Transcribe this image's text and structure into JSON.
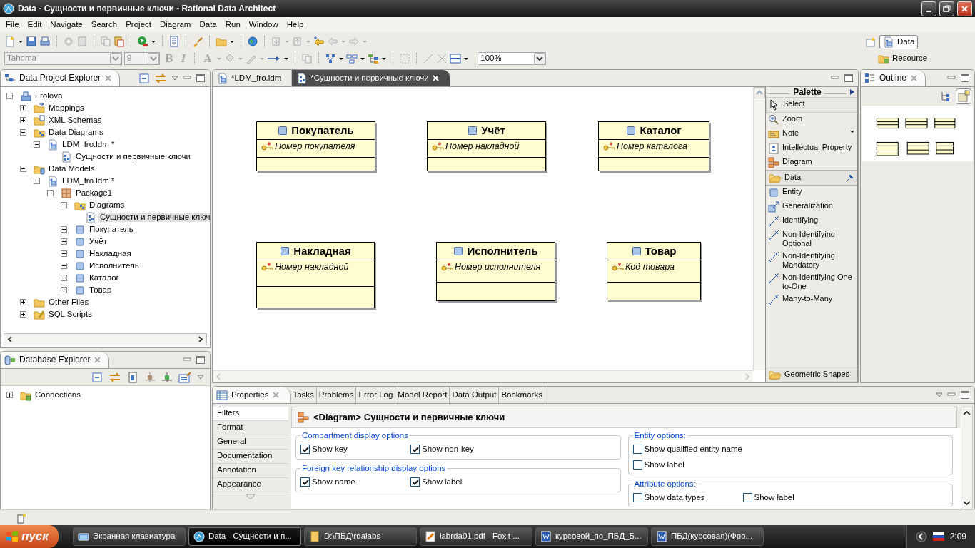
{
  "window": {
    "title": "Data - Сущности и первичные ключи - Rational Data Architect"
  },
  "menu": [
    "File",
    "Edit",
    "Navigate",
    "Search",
    "Project",
    "Diagram",
    "Data",
    "Run",
    "Window",
    "Help"
  ],
  "format_toolbar": {
    "font": "Tahoma",
    "size": "9",
    "bold": "B",
    "italic": "I",
    "font_color": "A",
    "zoom": "100%"
  },
  "perspectives": [
    {
      "label": "Data",
      "kind": "data",
      "selected": true
    },
    {
      "label": "Resource",
      "kind": "resource",
      "selected": false
    }
  ],
  "project_explorer": {
    "title": "Data Project Explorer",
    "tree": [
      {
        "label": "Frolova",
        "kind": "project",
        "expanded": true,
        "selected": false,
        "children": [
          {
            "label": "Mappings",
            "kind": "mappings",
            "expanded": false,
            "selected": false
          },
          {
            "label": "XML Schemas",
            "kind": "xml",
            "expanded": false,
            "selected": false
          },
          {
            "label": "Data Diagrams",
            "kind": "diagrams",
            "expanded": true,
            "selected": false,
            "children": [
              {
                "label": "LDM_fro.ldm *",
                "kind": "ldm",
                "expanded": true,
                "selected": false,
                "children": [
                  {
                    "label": "Сущности и первичные ключи",
                    "kind": "diagram",
                    "selected": false
                  }
                ]
              }
            ]
          },
          {
            "label": "Data Models",
            "kind": "models",
            "expanded": true,
            "selected": false,
            "children": [
              {
                "label": "LDM_fro.ldm *",
                "kind": "ldm",
                "expanded": true,
                "selected": false,
                "children": [
                  {
                    "label": "Package1",
                    "kind": "package",
                    "expanded": true,
                    "selected": false,
                    "children": [
                      {
                        "label": "Diagrams",
                        "kind": "diagrams",
                        "expanded": true,
                        "selected": false,
                        "children": [
                          {
                            "label": "Сущности и первичные ключ",
                            "kind": "diagram",
                            "selected": true
                          }
                        ]
                      },
                      {
                        "label": "Покупатель",
                        "kind": "entity",
                        "expanded": false,
                        "selected": false
                      },
                      {
                        "label": "Учёт",
                        "kind": "entity",
                        "expanded": false,
                        "selected": false
                      },
                      {
                        "label": "Накладная",
                        "kind": "entity",
                        "expanded": false,
                        "selected": false
                      },
                      {
                        "label": "Исполнитель",
                        "kind": "entity",
                        "expanded": false,
                        "selected": false
                      },
                      {
                        "label": "Каталог",
                        "kind": "entity",
                        "expanded": false,
                        "selected": false
                      },
                      {
                        "label": "Товар",
                        "kind": "entity",
                        "expanded": false,
                        "selected": false
                      }
                    ]
                  }
                ]
              }
            ]
          },
          {
            "label": "Other Files",
            "kind": "folder",
            "expanded": false,
            "selected": false
          },
          {
            "label": "SQL Scripts",
            "kind": "sql",
            "expanded": false,
            "selected": false
          }
        ]
      }
    ]
  },
  "database_explorer": {
    "title": "Database Explorer",
    "tree": [
      {
        "label": "Connections",
        "kind": "connections",
        "expanded": false,
        "selected": false
      }
    ]
  },
  "editor": {
    "tabs": [
      {
        "label": "*LDM_fro.ldm",
        "kind": "ldm",
        "selected": false
      },
      {
        "label": "*Сущности и первичные ключи",
        "kind": "diagram",
        "selected": true
      }
    ],
    "entities": [
      {
        "name": "Покупатель",
        "key": "Номер покупателя"
      },
      {
        "name": "Учёт",
        "key": "Номер накладной"
      },
      {
        "name": "Каталог",
        "key": "Номер каталога"
      },
      {
        "name": "Накладная",
        "key": "Номер накладной"
      },
      {
        "name": "Исполнитель",
        "key": "Номер исполнителя"
      },
      {
        "name": "Товар",
        "key": "Код товара"
      }
    ]
  },
  "palette": {
    "title": "Palette",
    "tools": [
      {
        "label": "Select",
        "kind": "select",
        "selected": true
      },
      {
        "label": "Zoom",
        "kind": "zoom",
        "selected": false
      },
      {
        "label": "Note",
        "kind": "note",
        "selected": false,
        "menu": true
      },
      {
        "label": "Intellectual Property",
        "kind": "ip",
        "selected": false
      },
      {
        "label": "Diagram",
        "kind": "diagram",
        "selected": false
      }
    ],
    "drawers": [
      {
        "label": "Data",
        "pinned": true,
        "items": [
          {
            "label": "Entity",
            "kind": "entity",
            "selected": false
          },
          {
            "label": "Generalization",
            "kind": "generalization",
            "selected": false
          },
          {
            "label": "Identifying",
            "kind": "relationship",
            "selected": false
          },
          {
            "label": "Non-Identifying Optional",
            "kind": "relationship",
            "selected": false
          },
          {
            "label": "Non-Identifying Mandatory",
            "kind": "relationship",
            "selected": false
          },
          {
            "label": "Non-Identifying One-to-One",
            "kind": "relationship",
            "selected": false
          },
          {
            "label": "Many-to-Many",
            "kind": "relationship",
            "selected": false
          }
        ]
      },
      {
        "label": "Geometric Shapes",
        "pinned": false
      }
    ]
  },
  "outline": {
    "title": "Outline"
  },
  "properties": {
    "tabs": [
      {
        "label": "Properties",
        "selected": true
      },
      {
        "label": "Tasks",
        "selected": false
      },
      {
        "label": "Problems",
        "selected": false
      },
      {
        "label": "Error Log",
        "selected": false
      },
      {
        "label": "Model Report",
        "selected": false
      },
      {
        "label": "Data Output",
        "selected": false
      },
      {
        "label": "Bookmarks",
        "selected": false
      }
    ],
    "side_tabs": [
      {
        "label": "Filters",
        "selected": true
      },
      {
        "label": "Format",
        "selected": false
      },
      {
        "label": "General",
        "selected": false
      },
      {
        "label": "Documentation",
        "selected": false
      },
      {
        "label": "Annotation",
        "selected": false
      },
      {
        "label": "Appearance",
        "selected": false
      }
    ],
    "heading": "<Diagram> Сущности и первичные ключи",
    "columns": [
      [
        {
          "title": "Compartment display options",
          "options": [
            {
              "label": "Show key",
              "checked": true
            },
            {
              "label": "Show non-key",
              "checked": true
            }
          ]
        },
        {
          "title": "Foreign key relationship display options",
          "options": [
            {
              "label": "Show name",
              "checked": true
            },
            {
              "label": "Show label",
              "checked": true
            }
          ]
        }
      ],
      [
        {
          "title": "Entity options:",
          "options": [
            {
              "label": "Show qualified entity name",
              "checked": false
            },
            {
              "label": "Show label",
              "checked": false
            }
          ],
          "stacked": true
        },
        {
          "title": "Attribute options:",
          "options": [
            {
              "label": "Show data types",
              "checked": false
            },
            {
              "label": "Show label",
              "checked": false
            }
          ]
        }
      ]
    ]
  },
  "taskbar": {
    "start": "пуск",
    "tasks": [
      {
        "label": "Экранная клавиатура",
        "kind": "keyboard",
        "selected": false
      },
      {
        "label": "Data - Сущности и п...",
        "kind": "app",
        "selected": true
      },
      {
        "label": "D:\\ПБД\\rdalabs",
        "kind": "folder",
        "selected": false
      },
      {
        "label": "labrda01.pdf - Foxit ...",
        "kind": "pdf",
        "selected": false
      },
      {
        "label": "курсовой_по_ПБД_Б...",
        "kind": "word",
        "selected": false
      },
      {
        "label": "ПБД(курсовая)(Фро...",
        "kind": "word",
        "selected": false
      }
    ],
    "clock": "2:09"
  }
}
